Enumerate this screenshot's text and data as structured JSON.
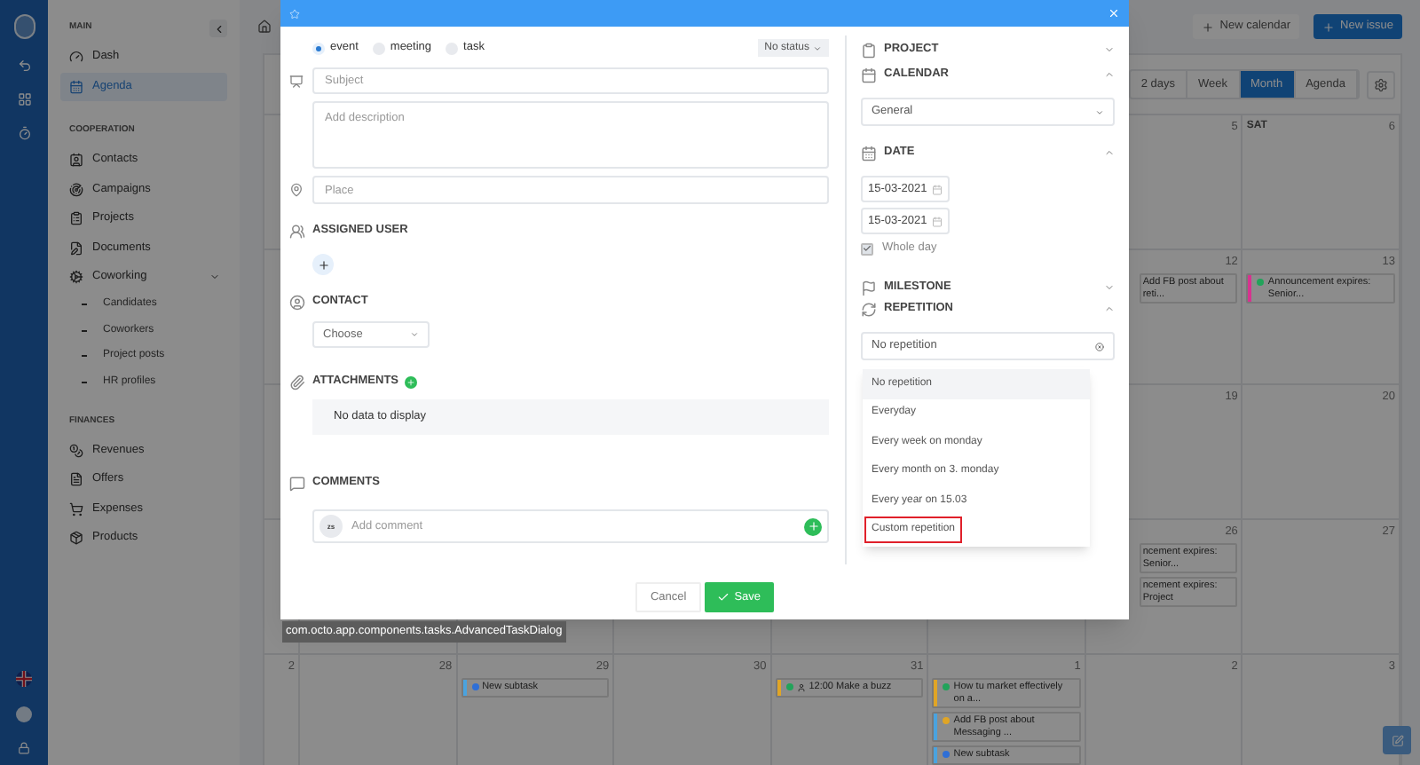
{
  "sidebar": {
    "sections": [
      {
        "title": "MAIN",
        "items": [
          {
            "label": "Dash",
            "selected": false
          },
          {
            "label": "Agenda",
            "selected": true
          }
        ]
      },
      {
        "title": "COOPERATION",
        "items": [
          {
            "label": "Contacts",
            "selected": false
          },
          {
            "label": "Campaigns",
            "selected": false
          },
          {
            "label": "Projects",
            "selected": false
          },
          {
            "label": "Documents",
            "selected": false
          },
          {
            "label": "Coworking",
            "selected": false,
            "expanded": true,
            "children": [
              {
                "label": "Candidates",
                "selected": false
              },
              {
                "label": "Coworkers",
                "selected": false
              },
              {
                "label": "Project posts",
                "selected": false
              },
              {
                "label": "HR profiles",
                "selected": false
              }
            ]
          }
        ]
      },
      {
        "title": "FINANCES",
        "items": [
          {
            "label": "Revenues",
            "selected": false
          },
          {
            "label": "Offers",
            "selected": false
          },
          {
            "label": "Expenses",
            "selected": false
          },
          {
            "label": "Products",
            "selected": false
          }
        ]
      }
    ]
  },
  "header": {
    "buttons": [
      {
        "label": "New calendar",
        "kind": "secondary"
      },
      {
        "label": "New issue",
        "kind": "primary"
      }
    ]
  },
  "calendar": {
    "views": [
      {
        "label": "2 days",
        "selected": false
      },
      {
        "label": "Week",
        "selected": false
      },
      {
        "label": "Month",
        "selected": true
      },
      {
        "label": "Agenda",
        "selected": false
      }
    ],
    "rows": [
      {
        "cells": [
          {
            "day": "5"
          },
          {
            "weekday": "SAT",
            "day": "6"
          }
        ]
      },
      {
        "cells": [
          {
            "day": "12",
            "events": [
              {
                "text": "Add FB post about reti..."
              }
            ]
          },
          {
            "day": "13",
            "events": [
              {
                "text": "Announcement expires: Senior...",
                "color": "#22a35a",
                "bar": {
                  "color": "#d6338f"
                }
              }
            ]
          }
        ]
      },
      {
        "cells": [
          {
            "day": "19"
          },
          {
            "day": "20"
          }
        ]
      },
      {
        "cells": [
          {
            "day": "26",
            "events": [
              {
                "text": "ncement expires: Senior..."
              },
              {
                "text": "ncement expires: Project"
              }
            ]
          },
          {
            "day": "27"
          }
        ]
      },
      {
        "cells": [
          {
            "day": "2"
          },
          {
            "day": "28"
          },
          {
            "day": "29",
            "events": [
              {
                "text": "New subtask",
                "color": "#2f6fd6",
                "bar": {
                  "color": "#4aa3df"
                }
              }
            ]
          },
          {
            "day": "30"
          },
          {
            "day": "31",
            "events": [
              {
                "text": "12:00 Make a buzz",
                "color": "#22a35a",
                "bar": {
                  "color": "#e0a526"
                },
                "person": true
              }
            ]
          },
          {
            "day": "1",
            "events": [
              {
                "text": "How tu market effectively on a...",
                "color": "#22a35a",
                "bar": {
                  "color": "#e0a526"
                }
              },
              {
                "text": "Add FB post about Messaging ...",
                "color": "#e0a526",
                "bar": {
                  "color": "#4aa3df"
                }
              },
              {
                "text": "New subtask",
                "color": "#2f6fd6",
                "bar": {
                  "color": "#4aa3df"
                }
              }
            ]
          },
          {
            "day": "2"
          },
          {
            "day": "3"
          }
        ]
      }
    ]
  },
  "dialog": {
    "types": [
      {
        "label": "event",
        "selected": true
      },
      {
        "label": "meeting",
        "selected": false
      },
      {
        "label": "task",
        "selected": false
      }
    ],
    "status": "No status",
    "subject": {
      "placeholder": "Subject"
    },
    "description": {
      "placeholder": "Add description"
    },
    "place": {
      "placeholder": "Place"
    },
    "assigned_user": {
      "title": "ASSIGNED USER"
    },
    "contact": {
      "title": "CONTACT",
      "value": "Choose"
    },
    "attachments": {
      "title": "ATTACHMENTS",
      "empty": "No data to display"
    },
    "comments": {
      "title": "COMMENTS",
      "avatar": "zs",
      "placeholder": "Add comment"
    },
    "buttons": [
      {
        "label": "Cancel",
        "kind": "secondary"
      },
      {
        "label": "Save",
        "kind": "primary"
      }
    ],
    "side": {
      "project": {
        "title": "PROJECT",
        "expanded": false
      },
      "calendar": {
        "title": "CALENDAR",
        "expanded": true,
        "value": "General"
      },
      "date": {
        "title": "DATE",
        "expanded": true,
        "start": "15-03-2021",
        "end": "15-03-2021",
        "whole_day": {
          "label": "Whole day",
          "checked": true
        }
      },
      "milestone": {
        "title": "MILESTONE",
        "expanded": false
      },
      "repetition": {
        "title": "REPETITION",
        "expanded": true,
        "value": "No repetition",
        "options": [
          {
            "label": "No repetition",
            "selected": true,
            "highlighted": false
          },
          {
            "label": "Everyday",
            "selected": false,
            "highlighted": false
          },
          {
            "label": "Every week on monday",
            "selected": false,
            "highlighted": false
          },
          {
            "label": "Every month on 3. monday",
            "selected": false,
            "highlighted": false
          },
          {
            "label": "Every year on 15.03",
            "selected": false,
            "highlighted": false
          },
          {
            "label": "Custom repetition",
            "selected": false,
            "highlighted": true
          }
        ]
      }
    }
  },
  "tooltip": "com.octo.app.components.tasks.AdvancedTaskDialog"
}
